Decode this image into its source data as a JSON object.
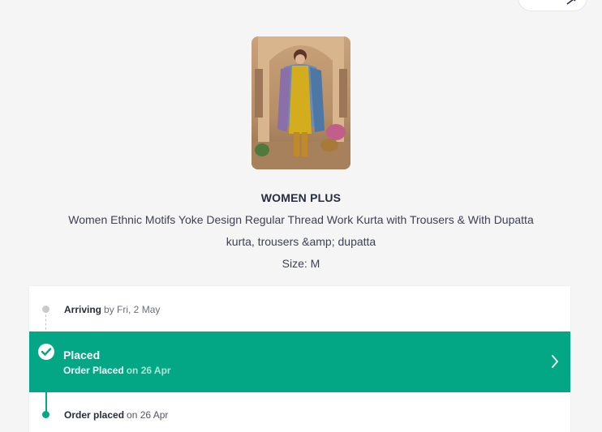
{
  "product": {
    "brand": "WOMEN PLUS",
    "name_line1": "Women Ethnic Motifs Yoke Design Regular Thread Work Kurta with Trousers & With Dupatta",
    "name_line2": "kurta, trousers &amp; dupatta",
    "size": "Size: M"
  },
  "timeline": {
    "arriving_label": "Arriving",
    "arriving_date": "by Fri, 2 May",
    "status_title": "Placed",
    "status_sub_label": "Order Placed",
    "status_sub_date": "on 26 Apr",
    "placed_label": "Order placed",
    "placed_date": "on 26 Apr"
  },
  "icons": {
    "top_chip": "edit-icon",
    "check": "check-circle-icon",
    "chevron": "chevron-right-icon"
  },
  "colors": {
    "accent": "#03a685",
    "background": "#f5f5f6",
    "text": "#282c3f"
  }
}
